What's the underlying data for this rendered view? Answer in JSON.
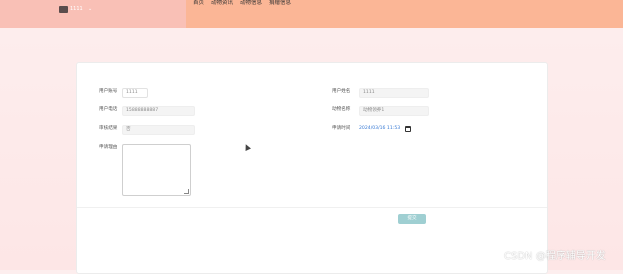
{
  "header": {
    "username": "1111",
    "user_caret": "⌄",
    "nav": [
      "首页",
      "动物资讯",
      "动物信息",
      "捐赠信息"
    ]
  },
  "form": {
    "user_account": {
      "label": "用户账号",
      "value": "1111"
    },
    "user_name": {
      "label": "用户姓名",
      "value": "1111"
    },
    "user_phone": {
      "label": "用户电话",
      "value": "15888888887"
    },
    "animal_name": {
      "label": "动物名称",
      "value": "动物领养1"
    },
    "approval_status": {
      "label": "审核结果",
      "value": "否"
    },
    "apply_time": {
      "label": "申请时间",
      "value": "2024/03/16 11:53"
    },
    "apply_reason": {
      "label": "申请理由",
      "value": ""
    },
    "submit_label": "提交"
  },
  "watermark": "CSDN @程序辅导开发"
}
